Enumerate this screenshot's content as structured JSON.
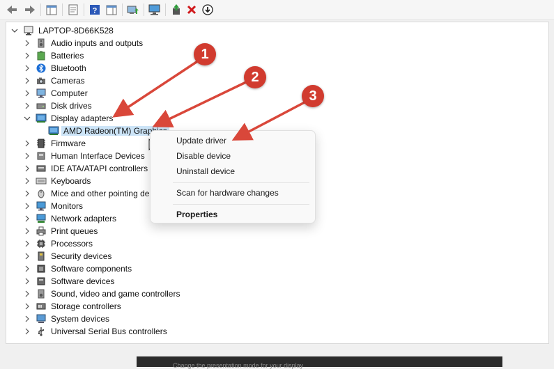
{
  "colors": {
    "arrow": "#d9473a",
    "badge": "#d13b2f",
    "selection": "#cce4f7"
  },
  "toolbar": {
    "icons": [
      "back-arrow-icon",
      "forward-arrow-icon",
      "show-hide-console-tree-icon",
      "properties-icon",
      "help-icon",
      "action-pane-icon",
      "update-driver-icon",
      "scan-hardware-icon",
      "enable-device-icon",
      "uninstall-device-icon",
      "disable-device-icon"
    ]
  },
  "tree": {
    "root": "LAPTOP-8D66K528",
    "categories": [
      {
        "label": "Audio inputs and outputs",
        "icon": "speaker-icon"
      },
      {
        "label": "Batteries",
        "icon": "battery-icon"
      },
      {
        "label": "Bluetooth",
        "icon": "bluetooth-icon"
      },
      {
        "label": "Cameras",
        "icon": "camera-icon"
      },
      {
        "label": "Computer",
        "icon": "computer-icon"
      },
      {
        "label": "Disk drives",
        "icon": "disk-drive-icon"
      },
      {
        "label": "Display adapters",
        "icon": "display-adapter-icon",
        "expanded": true
      },
      {
        "label": "AMD Radeon(TM) Graphics",
        "icon": "display-adapter-icon",
        "child": true,
        "selected": true
      },
      {
        "label": "Firmware",
        "icon": "firmware-icon"
      },
      {
        "label": "Human Interface Devices",
        "icon": "hid-icon"
      },
      {
        "label": "IDE ATA/ATAPI controllers",
        "icon": "ide-controller-icon"
      },
      {
        "label": "Keyboards",
        "icon": "keyboard-icon"
      },
      {
        "label": "Mice and other pointing de",
        "icon": "mouse-icon"
      },
      {
        "label": "Monitors",
        "icon": "monitor-icon"
      },
      {
        "label": "Network adapters",
        "icon": "network-adapter-icon"
      },
      {
        "label": "Print queues",
        "icon": "printer-icon"
      },
      {
        "label": "Processors",
        "icon": "processor-icon"
      },
      {
        "label": "Security devices",
        "icon": "security-device-icon"
      },
      {
        "label": "Software components",
        "icon": "software-component-icon"
      },
      {
        "label": "Software devices",
        "icon": "software-device-icon"
      },
      {
        "label": "Sound, video and game controllers",
        "icon": "sound-icon"
      },
      {
        "label": "Storage controllers",
        "icon": "storage-controller-icon"
      },
      {
        "label": "System devices",
        "icon": "system-device-icon"
      },
      {
        "label": "Universal Serial Bus controllers",
        "icon": "usb-icon"
      }
    ]
  },
  "context_menu": {
    "items": [
      "Update driver",
      "Disable device",
      "Uninstall device",
      "Scan for hardware changes",
      "Properties"
    ]
  },
  "callouts": [
    "1",
    "2",
    "3"
  ],
  "background_window": {
    "text": "Change the presentation mode for your display"
  }
}
